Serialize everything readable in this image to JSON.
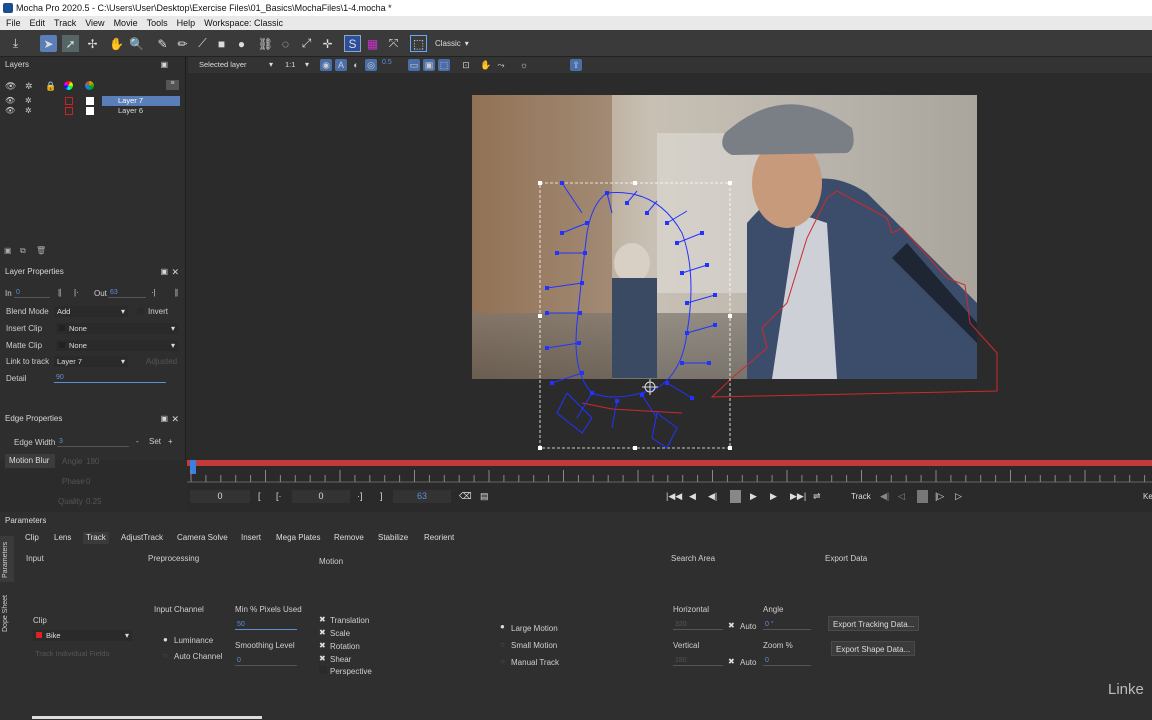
{
  "window": {
    "title": "Mocha Pro 2020.5 - C:\\Users\\User\\Desktop\\Exercise Files\\01_Basics\\MochaFiles\\1-4.mocha *"
  },
  "menu": [
    "File",
    "Edit",
    "Track",
    "View",
    "Movie",
    "Tools",
    "Help",
    "Workspace: Classic"
  ],
  "toolbar": {
    "workspace_label": "Classic",
    "view_mode": "Selected layer",
    "zoom": "1:1",
    "opacity_value": "0.5"
  },
  "layers_panel": {
    "title": "Layers",
    "layers": [
      {
        "name": "Layer 7",
        "selected": true
      },
      {
        "name": "Layer 6",
        "selected": false
      }
    ]
  },
  "layer_properties": {
    "title": "Layer Properties",
    "in_label": "In",
    "in_value": "0",
    "out_label": "Out",
    "out_value": "63",
    "blend_mode_label": "Blend Mode",
    "blend_mode_value": "Add",
    "invert_label": "Invert",
    "insert_clip_label": "Insert Clip",
    "insert_clip_value": "None",
    "matte_clip_label": "Matte Clip",
    "matte_clip_value": "None",
    "link_to_track_label": "Link to track",
    "link_to_track_value": "Layer 7",
    "adjusted_label": "Adjusted",
    "detail_label": "Detail",
    "detail_value": "90"
  },
  "edge_properties": {
    "title": "Edge Properties",
    "edge_width_label": "Edge Width",
    "edge_width_value": "3",
    "set_label": "Set",
    "motion_blur_label": "Motion Blur",
    "angle_label": "Angle",
    "angle_value": "180",
    "phase_label": "Phase",
    "phase_value": "0",
    "quality_label": "Quality",
    "quality_value": "0.25"
  },
  "timeline": {
    "current_frame": "0",
    "in_frame": "0",
    "out_frame": "63",
    "track_label": "Track",
    "right_edge_label": "Ke"
  },
  "parameters": {
    "title": "Parameters",
    "side_tabs": [
      "Parameters",
      "Dope Sheet"
    ],
    "tabs": [
      "Clip",
      "Lens",
      "Track",
      "AdjustTrack",
      "Camera Solve",
      "Insert",
      "Mega Plates",
      "Remove",
      "Stabilize",
      "Reorient"
    ],
    "active_tab": "Track",
    "input": {
      "heading": "Input",
      "clip_label": "Clip",
      "clip_value": "Bike",
      "track_individual_fields": "Track Individual Fields"
    },
    "preprocessing": {
      "heading": "Preprocessing",
      "input_channel_label": "Input Channel",
      "luminance": "Luminance",
      "auto_channel": "Auto Channel",
      "min_pixels_label": "Min % Pixels Used",
      "min_pixels_value": "50",
      "smoothing_label": "Smoothing Level",
      "smoothing_value": "0"
    },
    "motion": {
      "heading": "Motion",
      "options": [
        {
          "label": "Translation",
          "checked": true
        },
        {
          "label": "Scale",
          "checked": true
        },
        {
          "label": "Rotation",
          "checked": true
        },
        {
          "label": "Shear",
          "checked": true
        },
        {
          "label": "Perspective",
          "checked": false
        }
      ],
      "modes": [
        "Large Motion",
        "Small Motion",
        "Manual Track"
      ]
    },
    "search_area": {
      "heading": "Search Area",
      "horizontal_label": "Horizontal",
      "horizontal_value": "320",
      "vertical_label": "Vertical",
      "vertical_value": "180",
      "auto_label": "Auto",
      "angle_label": "Angle",
      "angle_value": "0 °",
      "zoom_label": "Zoom %",
      "zoom_value": "0"
    },
    "export_data": {
      "heading": "Export Data",
      "export_tracking": "Export Tracking Data...",
      "export_shape": "Export Shape Data..."
    }
  },
  "watermark": "Linke"
}
